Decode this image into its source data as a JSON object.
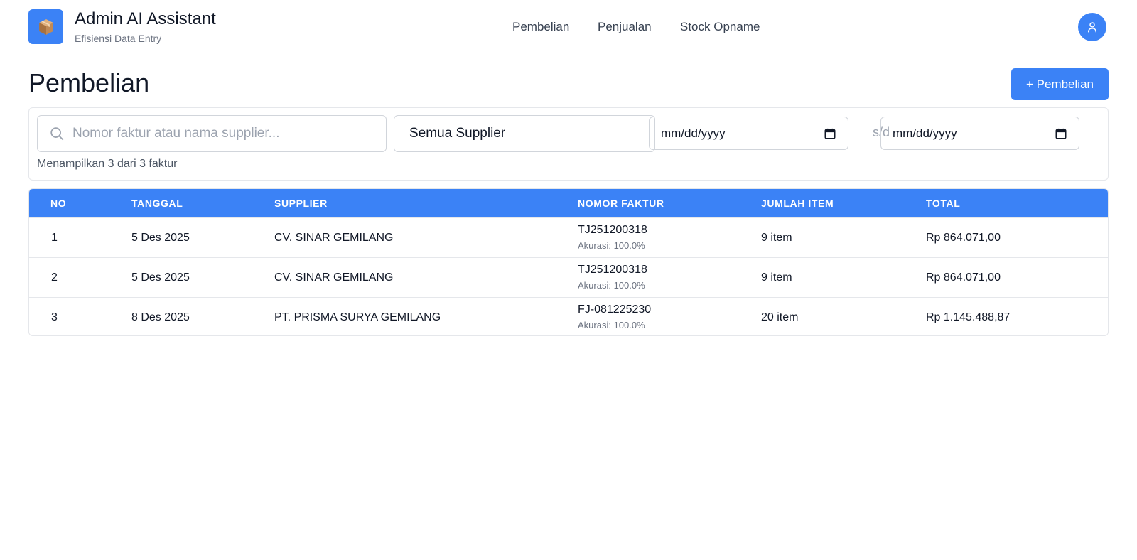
{
  "app": {
    "title": "Admin AI Assistant",
    "subtitle": "Efisiensi Data Entry",
    "logo_icon": "package-box-icon"
  },
  "nav": [
    {
      "label": "Pembelian"
    },
    {
      "label": "Penjualan"
    },
    {
      "label": "Stock Opname"
    }
  ],
  "user": {
    "icon": "user-icon"
  },
  "page": {
    "title": "Pembelian",
    "add_button": "+ Pembelian"
  },
  "filters": {
    "search_placeholder": "Nomor faktur atau nama supplier...",
    "supplier_select": "Semua Supplier",
    "date_from": "mm/dd/yyyy",
    "date_separator": "s/d",
    "date_to": "mm/dd/yyyy",
    "result_count": "Menampilkan 3 dari 3 faktur"
  },
  "table": {
    "headers": [
      "NO",
      "TANGGAL",
      "SUPPLIER",
      "NOMOR FAKTUR",
      "JUMLAH ITEM",
      "TOTAL"
    ],
    "rows": [
      {
        "no": "1",
        "tanggal": "5 Des 2025",
        "supplier": "CV. SINAR GEMILANG",
        "faktur": "TJ251200318",
        "akurasi": "Akurasi: 100.0%",
        "jumlah": "9 item",
        "total": "Rp 864.071,00"
      },
      {
        "no": "2",
        "tanggal": "5 Des 2025",
        "supplier": "CV. SINAR GEMILANG",
        "faktur": "TJ251200318",
        "akurasi": "Akurasi: 100.0%",
        "jumlah": "9 item",
        "total": "Rp 864.071,00"
      },
      {
        "no": "3",
        "tanggal": "8 Des 2025",
        "supplier": "PT. PRISMA SURYA GEMILANG",
        "faktur": "FJ-081225230",
        "akurasi": "Akurasi: 100.0%",
        "jumlah": "20 item",
        "total": "Rp 1.145.488,87"
      }
    ]
  },
  "colors": {
    "accent": "#3b82f6",
    "border": "#e5e7eb",
    "text": "#111827",
    "muted": "#6b7280"
  }
}
